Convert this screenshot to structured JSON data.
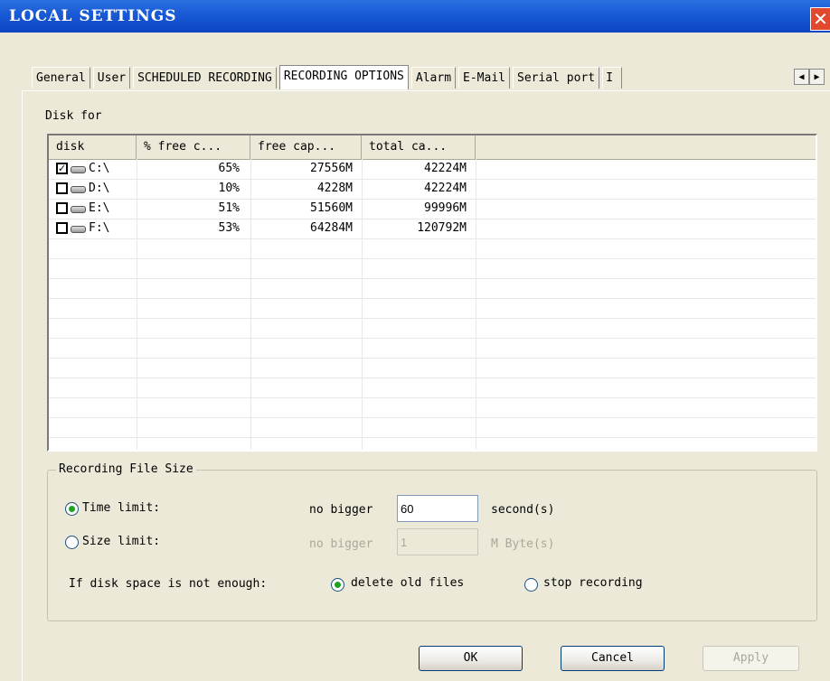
{
  "window": {
    "title": "LOCAL SETTINGS",
    "close_glyph": "✕"
  },
  "tabs": [
    {
      "label": "General",
      "active": false
    },
    {
      "label": "User",
      "active": false
    },
    {
      "label": "SCHEDULED RECORDING",
      "active": false
    },
    {
      "label": "RECORDING OPTIONS",
      "active": true
    },
    {
      "label": "Alarm",
      "active": false
    },
    {
      "label": "E-Mail",
      "active": false
    },
    {
      "label": "Serial port",
      "active": false
    },
    {
      "label": "I",
      "active": false
    }
  ],
  "tab_scroll": {
    "left_glyph": "◀",
    "right_glyph": "▶"
  },
  "disk_section": {
    "label": "Disk for",
    "columns": [
      "disk",
      "% free c...",
      "free cap...",
      "total ca..."
    ],
    "rows": [
      {
        "checked": true,
        "disk": "C:\\",
        "pct_free": "65%",
        "free_cap": "27556M",
        "total_cap": "42224M"
      },
      {
        "checked": false,
        "disk": "D:\\",
        "pct_free": "10%",
        "free_cap": "4228M",
        "total_cap": "42224M"
      },
      {
        "checked": false,
        "disk": "E:\\",
        "pct_free": "51%",
        "free_cap": "51560M",
        "total_cap": "99996M"
      },
      {
        "checked": false,
        "disk": "F:\\",
        "pct_free": "53%",
        "free_cap": "64284M",
        "total_cap": "120792M"
      }
    ]
  },
  "file_size": {
    "group_title": "Recording File Size",
    "time_limit": {
      "label": "Time limit:",
      "selected": true,
      "prefix": "no bigger",
      "value": "60",
      "unit": "second(s)"
    },
    "size_limit": {
      "label": "Size limit:",
      "selected": false,
      "prefix": "no bigger",
      "value": "1",
      "unit": "M Byte(s)"
    },
    "disk_space": {
      "label": "If disk space is not enough:",
      "options": [
        {
          "label": "delete old files",
          "selected": true
        },
        {
          "label": "stop recording",
          "selected": false
        }
      ]
    }
  },
  "buttons": {
    "ok": "OK",
    "cancel": "Cancel",
    "apply": "Apply"
  }
}
